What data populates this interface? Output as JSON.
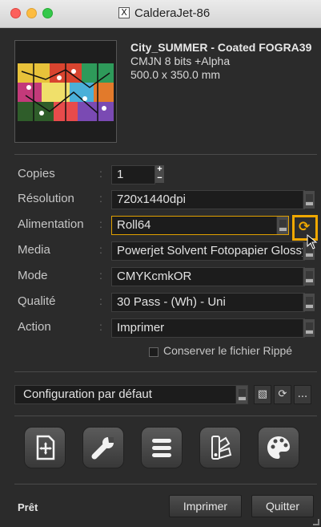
{
  "window": {
    "title": "CalderaJet-86",
    "app_icon_glyph": "X"
  },
  "file": {
    "name": "City_SUMMER - Coated FOGRA39",
    "color_mode": "CMJN 8 bits +Alpha",
    "size": "500.0 x 350.0 mm"
  },
  "settings": [
    {
      "label": "Copies",
      "value": "1"
    },
    {
      "label": "Résolution",
      "value": "720x1440dpi"
    },
    {
      "label": "Alimentation",
      "value": "Roll64"
    },
    {
      "label": "Media",
      "value": "Powerjet Solvent Fotopapier Glossy"
    },
    {
      "label": "Mode",
      "value": "CMYKcmkOR"
    },
    {
      "label": "Qualité",
      "value": "30 Pass - (Wh) - Uni"
    },
    {
      "label": "Action",
      "value": "Imprimer"
    }
  ],
  "colon": ":",
  "stepper": {
    "up": "+",
    "down": "−"
  },
  "keep_ripped_label": "Conserver le fichier Rippé",
  "preset": {
    "value": "Configuration par défaut",
    "more_label": "..."
  },
  "tools": [
    "add-page-icon",
    "wrench-icon",
    "queue-list-icon",
    "color-swatches-icon",
    "palette-icon"
  ],
  "footer": {
    "status": "Prêt",
    "print_label": "Imprimer",
    "quit_label": "Quitter"
  },
  "colors": {
    "accent": "#f0a800",
    "panel": "#2b2b2b",
    "field": "#1c1c1c"
  }
}
